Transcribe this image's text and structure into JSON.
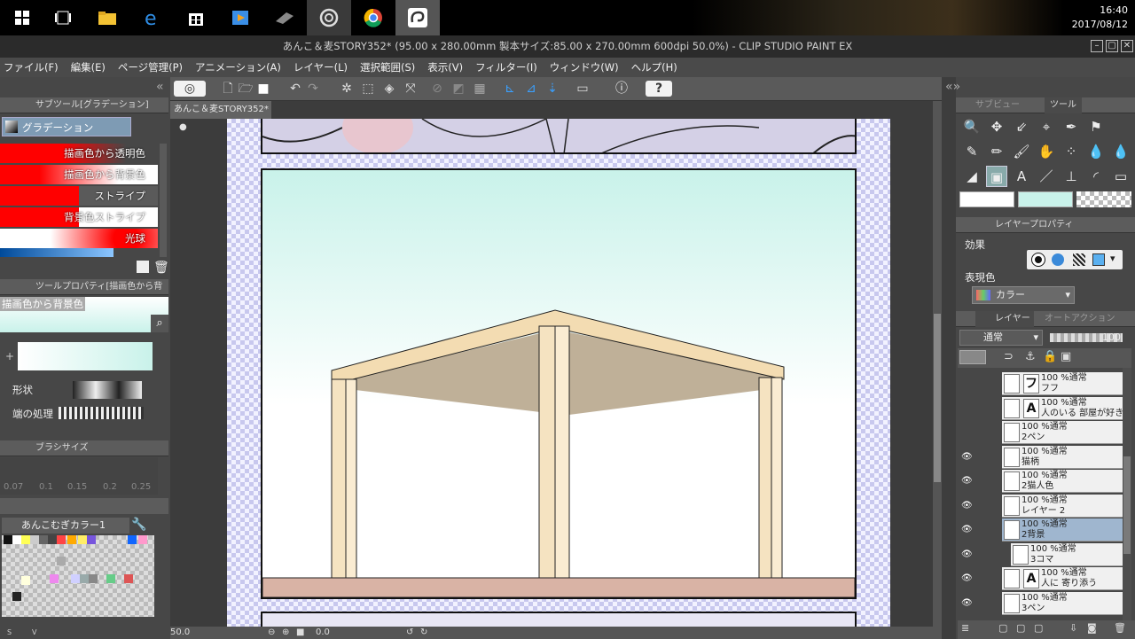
{
  "taskbar": {
    "time": "16:40",
    "date": "2017/08/12"
  },
  "window": {
    "title": "あんこ＆麦STORY352* (95.00 x 280.00mm 製本サイズ:85.00 x 270.00mm 600dpi 50.0%)  - CLIP STUDIO PAINT EX"
  },
  "menu": [
    "ファイル(F)",
    "編集(E)",
    "ページ管理(P)",
    "アニメーション(A)",
    "レイヤー(L)",
    "選択範囲(S)",
    "表示(V)",
    "フィルター(I)",
    "ウィンドウ(W)",
    "ヘルプ(H)"
  ],
  "document_tab": "あんこ＆麦STORY352*",
  "subtool": {
    "header": "サブツール[グラデーション]",
    "group": "グラデーション",
    "items": [
      "描画色から透明色",
      "描画色から背景色",
      "ストライプ",
      "背景色ストライプ",
      "光球"
    ]
  },
  "tool_property": {
    "header": "ツールプロパティ[描画色から背景色]",
    "preset": "描画色から背景色",
    "shape_label": "形状",
    "edge_label": "端の処理"
  },
  "brush_size": {
    "header": "ブラシサイズ",
    "values": [
      "0.07",
      "0.1",
      "0.15",
      "0.2",
      "0.25"
    ]
  },
  "color_set": {
    "name": "あんこむぎカラー1",
    "tabs": [
      "S",
      "V"
    ]
  },
  "status": {
    "zoom": "50.0",
    "angle": "0.0"
  },
  "right_tabs": {
    "subview": "サブビュー",
    "tool": "ツール"
  },
  "layer_property": {
    "header": "レイヤープロパティ",
    "effect_label": "効果",
    "color_label": "表現色",
    "color_value": "カラー"
  },
  "layer_panel": {
    "tab1": "レイヤー",
    "tab2": "オートアクション",
    "blend": "通常",
    "opacity": "100",
    "layers": [
      {
        "mode": "100 %通常",
        "name": "フフ"
      },
      {
        "mode": "100 %通常",
        "name": "人のいる 部屋が好き"
      },
      {
        "mode": "100 %通常",
        "name": "2ペン"
      },
      {
        "mode": "100 %通常",
        "name": "猫柄"
      },
      {
        "mode": "100 %通常",
        "name": "2猫人色"
      },
      {
        "mode": "100 %通常",
        "name": "レイヤー 2"
      },
      {
        "mode": "100 %通常",
        "name": "2背景"
      },
      {
        "mode": "100 %通常",
        "name": "3コマ"
      },
      {
        "mode": "100 %通常",
        "name": "人に 寄り添う"
      },
      {
        "mode": "100 %通常",
        "name": "3ペン"
      }
    ]
  },
  "colors": {
    "fg": "#ffffff",
    "bg": "#c9f2ea",
    "accent": "#3b8ad9"
  }
}
